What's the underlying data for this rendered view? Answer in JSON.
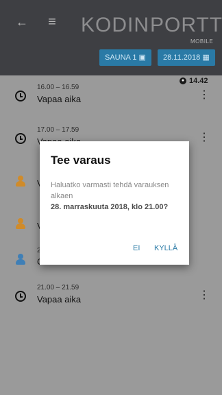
{
  "header": {
    "back_icon": "arrow-left-icon",
    "menu_icon": "hamburger-menu-icon",
    "logo_text_1": "KODIN",
    "logo_text_2": "PORTTI",
    "logo_suffix": "MOBILE"
  },
  "filters": {
    "sauna_label": "SAUNA 1",
    "sauna_icon": "dropdown-box-icon",
    "date_label": "28.11.2018",
    "date_icon": "calendar-icon"
  },
  "rows": [
    {
      "time": "16.00 – 16.59",
      "status": "Vapaa aika",
      "icon": "clock-icon",
      "marker": "14.42"
    },
    {
      "time": "17.00 – 17.59",
      "status": "Vapaa aika",
      "icon": "clock-icon"
    },
    {
      "time": "",
      "status": "V",
      "icon": "person-icon",
      "icon_color": "#d08b2a"
    },
    {
      "time": "",
      "status": "V",
      "icon": "person-icon",
      "icon_color": "#d08b2a"
    },
    {
      "time": "2",
      "status": "C",
      "icon": "person-icon",
      "icon_color": "#3f7fb6"
    },
    {
      "time": "21.00 – 21.59",
      "status": "Vapaa aika",
      "icon": "clock-icon"
    }
  ],
  "dialog": {
    "title": "Tee varaus",
    "text": "Haluatko varmasti tehdä varauksen alkaen",
    "highlight": "28. marraskuuta 2018, klo 21.00?",
    "cancel": "EI",
    "confirm": "KYLLÄ"
  },
  "colors": {
    "accent": "#2a7aa6",
    "header": "#3e3f43",
    "list_bg": "#9a9a9a"
  }
}
